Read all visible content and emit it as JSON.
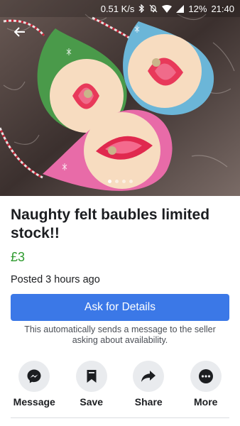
{
  "status_bar": {
    "speed": "0.51 K/s",
    "battery": "12%",
    "time": "21:40"
  },
  "gallery": {
    "slide_count": 4,
    "active_slide": 1
  },
  "listing": {
    "title": "Naughty felt baubles limited stock!!",
    "price": "£3",
    "posted": "Posted 3 hours ago"
  },
  "cta": {
    "label": "Ask for Details",
    "note": "This automatically sends a message to the seller asking about availability."
  },
  "actions": [
    {
      "label": "Message",
      "icon": "messenger-icon"
    },
    {
      "label": "Save",
      "icon": "bookmark-icon"
    },
    {
      "label": "Share",
      "icon": "share-icon"
    },
    {
      "label": "More",
      "icon": "more-icon"
    }
  ],
  "colors": {
    "primary": "#3b78e7",
    "price": "#2e9a2e",
    "action_bg": "#e9ebee"
  }
}
